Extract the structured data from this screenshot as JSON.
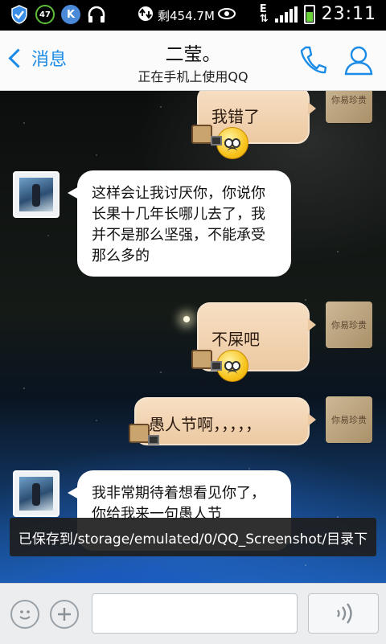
{
  "status_bar": {
    "download_text": "剩454.7M",
    "clock": "23:11",
    "badge_count": "47",
    "k_badge": "K"
  },
  "header": {
    "back_label": "消息",
    "title": "二莹。",
    "subtitle": "正在手机上使用QQ"
  },
  "messages": [
    {
      "side": "out",
      "text": "我错了"
    },
    {
      "side": "in",
      "text": "这样会让我讨厌你，你说你长果十几年长哪儿去了，我并不是那么坚强，不能承受那么多的"
    },
    {
      "side": "out",
      "text": "不屎吧"
    },
    {
      "side": "out",
      "text": "愚人节啊，，，，，"
    },
    {
      "side": "in",
      "text": "我非常期待着想看见你了，你给我来一句愚人节"
    }
  ],
  "my_avatar_text": "你易珍贵",
  "toast": "已保存到/storage/emulated/0/QQ_Screenshot/目录下",
  "input_bar": {
    "input_value": ""
  },
  "colors": {
    "accent": "#1a8be6",
    "outgoing_bubble": "#ecc9a2",
    "incoming_bubble": "#ffffff"
  }
}
